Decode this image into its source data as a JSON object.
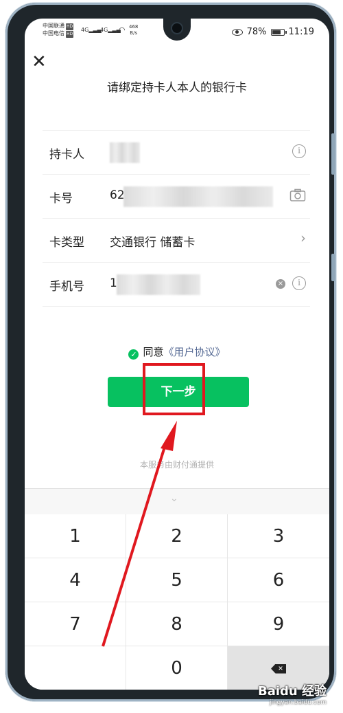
{
  "status_bar": {
    "carrier_1": "中国联通",
    "carrier_2": "中国电信",
    "hd_1": "HD",
    "hd_2": "HD",
    "signal_1": "4G",
    "signal_2": "4G",
    "speed_value": "468",
    "speed_unit": "B/s",
    "battery": "78%",
    "time": "11:19"
  },
  "page": {
    "title": "请绑定持卡人本人的银行卡"
  },
  "form": {
    "holder_label": "持卡人",
    "card_label": "卡号",
    "card_value": "62",
    "type_label": "卡类型",
    "type_value": "交通银行  储蓄卡",
    "phone_label": "手机号",
    "phone_value": "1"
  },
  "agreement": {
    "prefix": "同意",
    "link": "《用户协议》"
  },
  "next_button": "下一步",
  "provider": "本服务由财付通提供",
  "keypad": [
    "1",
    "2",
    "3",
    "4",
    "5",
    "6",
    "7",
    "8",
    "9",
    "",
    "0",
    "del"
  ],
  "watermark": {
    "logo": "Baidu 经验",
    "url": "jingyan.baidu.com"
  },
  "colors": {
    "primary": "#07c160",
    "link": "#576b95",
    "annotation": "#e0181f"
  }
}
